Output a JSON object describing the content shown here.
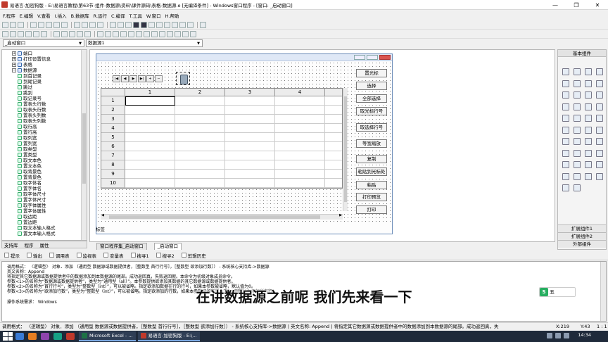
{
  "window": {
    "title": "易语言-加密狗版 - E:\\易语言教程\\第63节-组件-数据源\\资料\\课件源码\\表格-数据源.e [无编译条件] - Windows窗口程序 - [窗口: _启动窗口]",
    "min_glyph": "—",
    "max_glyph": "❐",
    "close_glyph": "✕"
  },
  "menu": [
    "F.程序",
    "E.编辑",
    "V.查看",
    "I.插入",
    "B.数据库",
    "R.运行",
    "C.编译",
    "T.工具",
    "W.窗口",
    "H.帮助"
  ],
  "combos": {
    "window_select": "_启动窗口",
    "component_select": "数据源1",
    "arrow": "▼"
  },
  "left_panel": {
    "tree": [
      {
        "label": "端口",
        "type": "plus"
      },
      {
        "label": "打印设置信息",
        "type": "plus"
      },
      {
        "label": "表格",
        "type": "plus"
      },
      {
        "label": "数据源",
        "type": "minus"
      },
      {
        "label": "到首记录",
        "type": "item"
      },
      {
        "label": "到尾记录",
        "type": "item"
      },
      {
        "label": "跳过",
        "type": "item"
      },
      {
        "label": "跳到",
        "type": "item"
      },
      {
        "label": "取记录号",
        "type": "item"
      },
      {
        "label": "置表头行数",
        "type": "item"
      },
      {
        "label": "取表头行数",
        "type": "item"
      },
      {
        "label": "置表头列数",
        "type": "item"
      },
      {
        "label": "取表头列数",
        "type": "item"
      },
      {
        "label": "取行高",
        "type": "item"
      },
      {
        "label": "置行高",
        "type": "item"
      },
      {
        "label": "取列宽",
        "type": "item"
      },
      {
        "label": "置列宽",
        "type": "item"
      },
      {
        "label": "取类型",
        "type": "item"
      },
      {
        "label": "置类型",
        "type": "item"
      },
      {
        "label": "取文本色",
        "type": "item"
      },
      {
        "label": "置文本色",
        "type": "item"
      },
      {
        "label": "取背景色",
        "type": "item"
      },
      {
        "label": "置背景色",
        "type": "item"
      },
      {
        "label": "取字体名",
        "type": "item"
      },
      {
        "label": "置字体名",
        "type": "item"
      },
      {
        "label": "取字体尺寸",
        "type": "item"
      },
      {
        "label": "置字体尺寸",
        "type": "item"
      },
      {
        "label": "取字体属性",
        "type": "item"
      },
      {
        "label": "置字体属性",
        "type": "item"
      },
      {
        "label": "取边距",
        "type": "item"
      },
      {
        "label": "置边距",
        "type": "item"
      },
      {
        "label": "取文本输入格式",
        "type": "item"
      },
      {
        "label": "置文本输入格式",
        "type": "item"
      }
    ],
    "tabs": [
      "支持库",
      "程序",
      "属性"
    ]
  },
  "form": {
    "nav_buttons": [
      "|◀",
      "◀",
      "▶",
      "▶|",
      "+",
      "−"
    ],
    "grid": {
      "col_headers": [
        "1",
        "2",
        "3",
        "4"
      ],
      "row_headers": [
        "1",
        "2",
        "3",
        "4",
        "5",
        "6",
        "7",
        "8",
        "9",
        "10"
      ]
    },
    "buttons": [
      "置光标",
      "选择",
      "全部选择",
      "取光标行号",
      "取选择行号",
      "等宽缩放",
      "复制",
      "粘贴到光标处",
      "粘贴",
      "打印预览",
      "打印"
    ],
    "label": "标签",
    "scroll_left": "◀",
    "scroll_right": "▶"
  },
  "design_tabs": [
    "窗口程序集_启动窗口",
    "_启动窗口"
  ],
  "right_panel": {
    "title": "基本组件",
    "tabs": [
      "扩展组件1",
      "扩展组件2",
      "外部组件"
    ]
  },
  "output_tabs": [
    "提示",
    "输出",
    "调用表",
    "监视表",
    "变量表",
    "搜寻1",
    "搜寻2",
    "剪辑历史"
  ],
  "output_lines": [
    "调用格式： 〈逻辑型〉 对象．添加 （通用型 数据源或数据提供者，［整数型 首行行号］，［整数型 欲添加行数］） - 系统核心支持库->数据源",
    "英文名称：Append",
    "将指定其它数据源或数据提供者中的数据添加到本数据源的尾部。成功返回真，失败返回假。本命令为初级对象成员命令。",
    "参数<1>的名称为“数据源或数据提供者”，类型为“通用型（all）”。本参数提供欲添加其数据的其它数据源或数据提供者。",
    "参数<2>的名称为“首行行号”，类型为“整数型（int）”，可以被省略。指定欲添加数据在行的行号，如果本参数被省略，默认值为0。",
    "参数<3>的名称为“欲添加行数”，类型为“整数型（int）”，可以被省略。指定欲添加的行数，如果本参数被省略或小于0，则默认为添加所有行。",
    "",
    "操作系统需求： Windows"
  ],
  "subtitle": "在讲数据源之前呢 我们先来看一下",
  "ime": {
    "logo": "S",
    "text": "五"
  },
  "status": {
    "text": "调用格式： 〈逻辑型〉 对象．添加 （通用型 数据源或数据提供者，［整数型 首行行号］，［整数型 欲添加行数］） - 系统核心支持库->数据源  |  英文名称: Append  |  将指定其它数据源或数据提供者中的数据添加到本数据源的尾部。成功返回真，失",
    "x": "X:219",
    "y": "Y:43",
    "pos": "1 : 1"
  },
  "taskbar": {
    "tasks": [
      "Microsoft Excel - ...",
      "易语言-加密狗版 - E:\\..."
    ],
    "clock": "14:34"
  }
}
